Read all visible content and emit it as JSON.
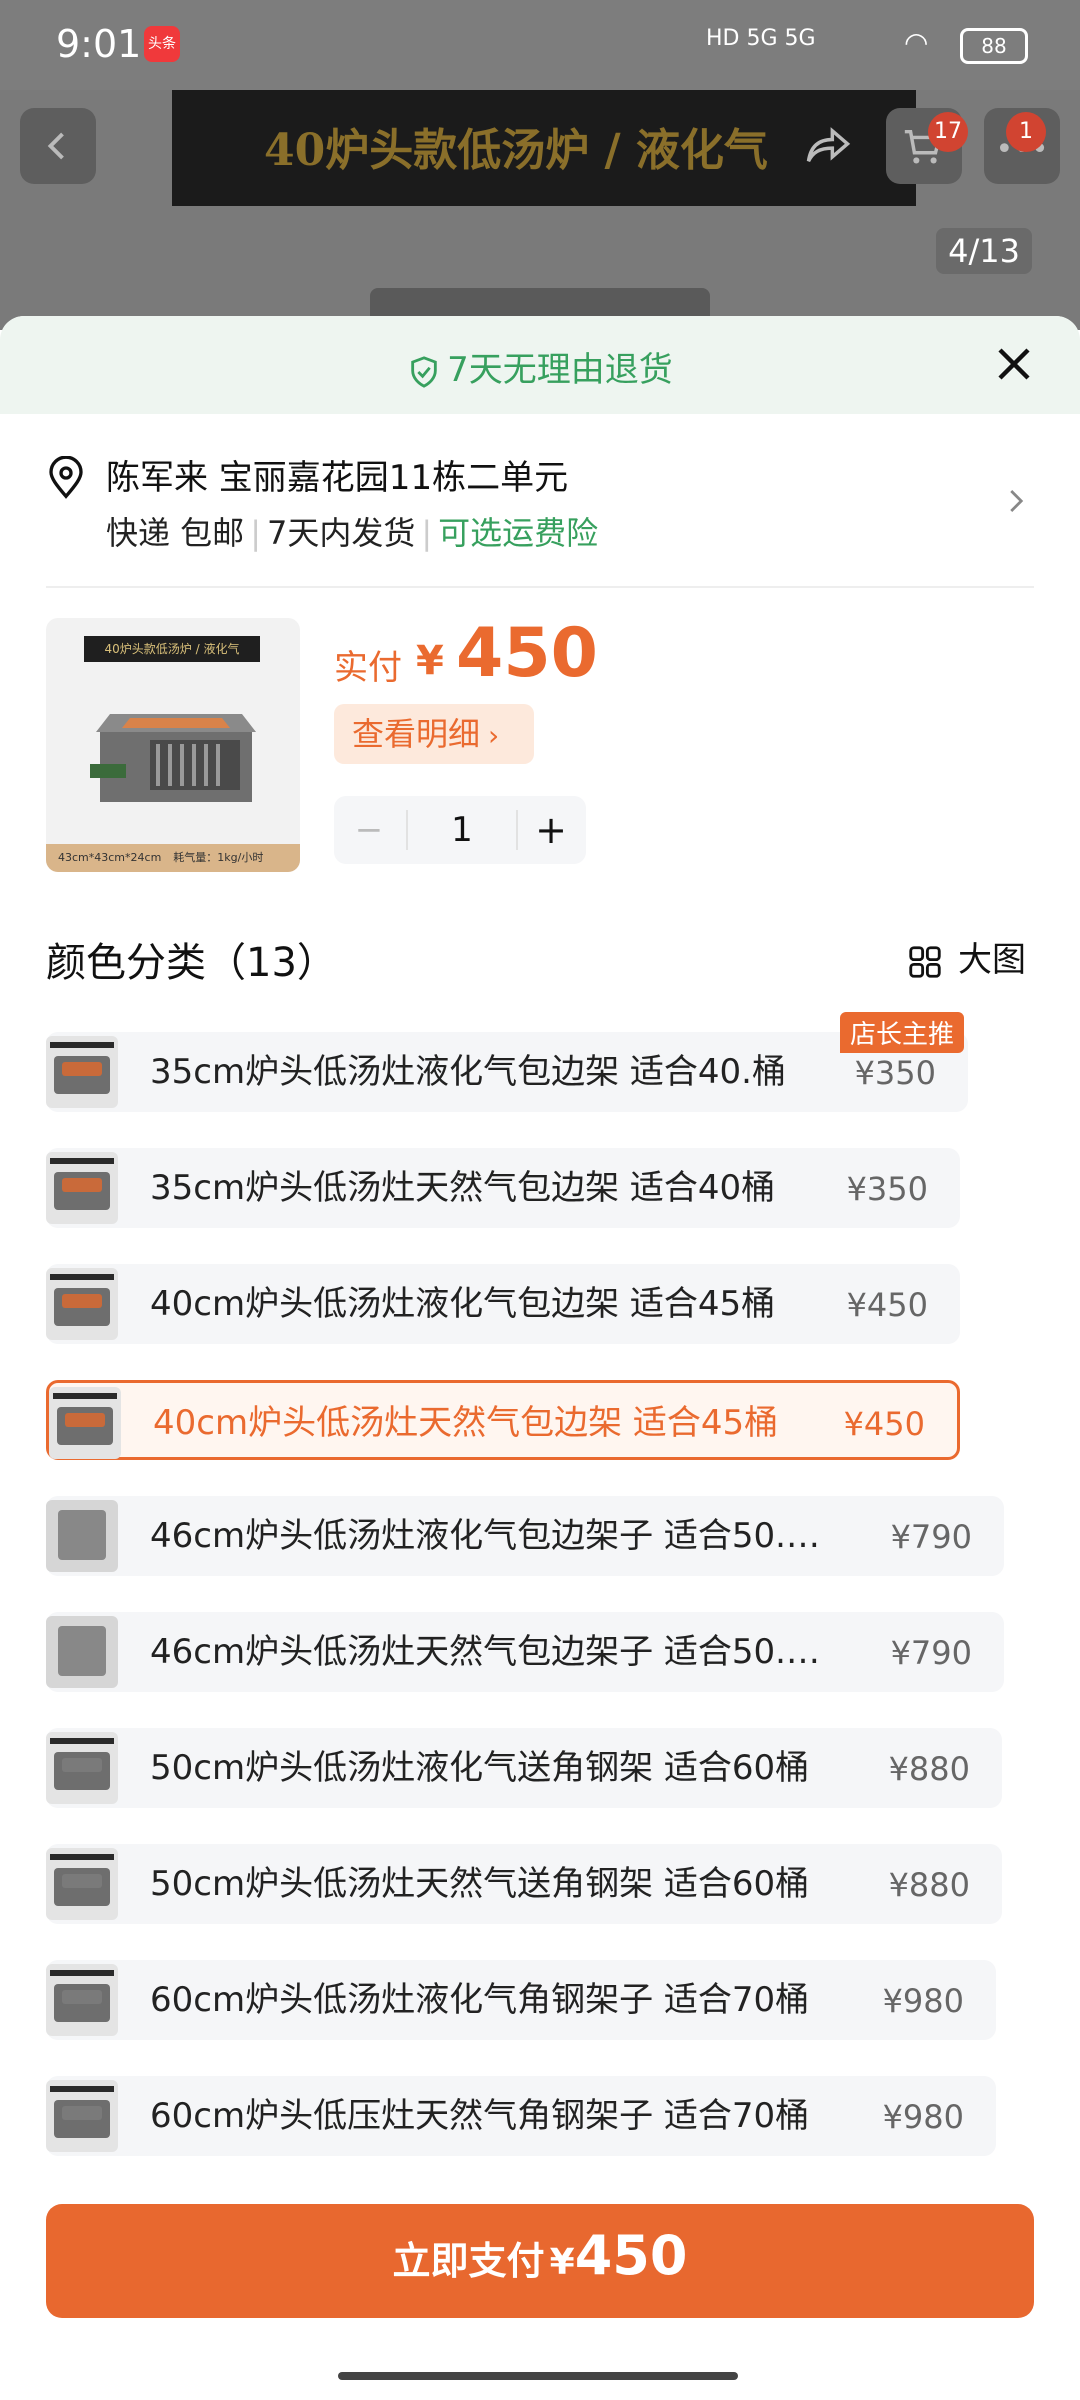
{
  "status_bar": {
    "time": "9:01",
    "app_badge": "头条",
    "network": "HD 5G 5G",
    "battery": "88"
  },
  "background": {
    "banner_text": "40炉头款低汤炉 / 液化气",
    "cart_count": "17",
    "more_count": "1",
    "page_indicator": "4/13"
  },
  "sheet": {
    "return_policy": "7天无理由退货",
    "address": {
      "name_line": "陈军来 宝丽嘉花园11栋二单元",
      "shipping": "快递 包邮",
      "delivery": "7天内发货",
      "insurance": "可选运费险"
    },
    "product": {
      "thumb_title": "40炉头款低汤炉 / 液化气",
      "thumb_size": "43cm*43cm*24cm",
      "thumb_gas": "耗气量：1kg/小时",
      "pay_label": "实付",
      "currency": "¥",
      "price": "450",
      "detail_label": "查看明细",
      "quantity": "1",
      "minus": "−",
      "plus": "+"
    },
    "section_title": "颜色分类（13）",
    "big_view_label": "大图",
    "options": [
      {
        "label": "35cm炉头低汤灶液化气包边架 适合40.桶",
        "price": "¥350",
        "tag": "店长主推",
        "selected": false
      },
      {
        "label": "35cm炉头低汤灶天然气包边架 适合40桶",
        "price": "¥350",
        "selected": false
      },
      {
        "label": "40cm炉头低汤灶液化气包边架 适合45桶",
        "price": "¥450",
        "selected": false
      },
      {
        "label": "40cm炉头低汤灶天然气包边架 适合45桶",
        "price": "¥450",
        "selected": true
      },
      {
        "label": "46cm炉头低汤灶液化气包边架子 适合50.…",
        "price": "¥790",
        "selected": false
      },
      {
        "label": "46cm炉头低汤灶天然气包边架子 适合50.…",
        "price": "¥790",
        "selected": false
      },
      {
        "label": "50cm炉头低汤灶液化气送角钢架 适合60桶",
        "price": "¥880",
        "selected": false
      },
      {
        "label": "50cm炉头低汤灶天然气送角钢架 适合60桶",
        "price": "¥880",
        "selected": false
      },
      {
        "label": "60cm炉头低汤灶液化气角钢架子 适合70桶",
        "price": "¥980",
        "selected": false
      },
      {
        "label": "60cm炉头低压灶天然气角钢架子 适合70桶",
        "price": "¥980",
        "selected": false
      }
    ],
    "pay_button": {
      "label": "立即支付",
      "currency": "¥",
      "amount": "450"
    }
  },
  "colors": {
    "accent": "#ea6a2f",
    "green": "#37a05e"
  }
}
